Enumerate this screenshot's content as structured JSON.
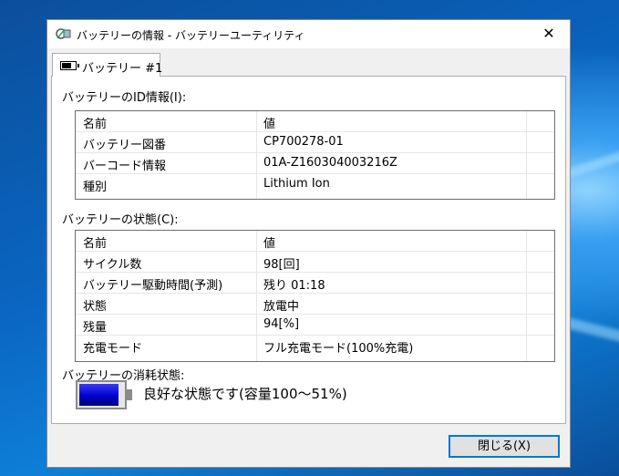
{
  "window": {
    "title": "バッテリーの情報 - バッテリーユーティリティ",
    "close_glyph": "✕"
  },
  "tab": {
    "label": "バッテリー #1"
  },
  "id_section": {
    "label": "バッテリーのID情報(I):",
    "header": [
      "名前",
      "値"
    ],
    "rows": [
      [
        "バッテリー図番",
        "CP700278-01"
      ],
      [
        "バーコード情報",
        "01A-Z160304003216Z"
      ],
      [
        "種別",
        "Lithium Ion"
      ]
    ]
  },
  "state_section": {
    "label": "バッテリーの状態(C):",
    "header": [
      "名前",
      "値"
    ],
    "rows": [
      [
        "サイクル数",
        "98[回]"
      ],
      [
        "バッテリー駆動時間(予測)",
        "残り 01:18"
      ],
      [
        "状態",
        "放電中"
      ],
      [
        "残量",
        "94[%]"
      ],
      [
        "充電モード",
        "フル充電モード(100%充電)"
      ]
    ]
  },
  "wear": {
    "label": "バッテリーの消耗状態:",
    "status_text": "良好な状態です(容量100〜51%)",
    "level": 0.9,
    "fill_color": "#0000c8",
    "icon": "battery-level-icon"
  },
  "buttons": {
    "close_label": "閉じる(X)"
  },
  "colors": {
    "accent": "#0078d7"
  }
}
